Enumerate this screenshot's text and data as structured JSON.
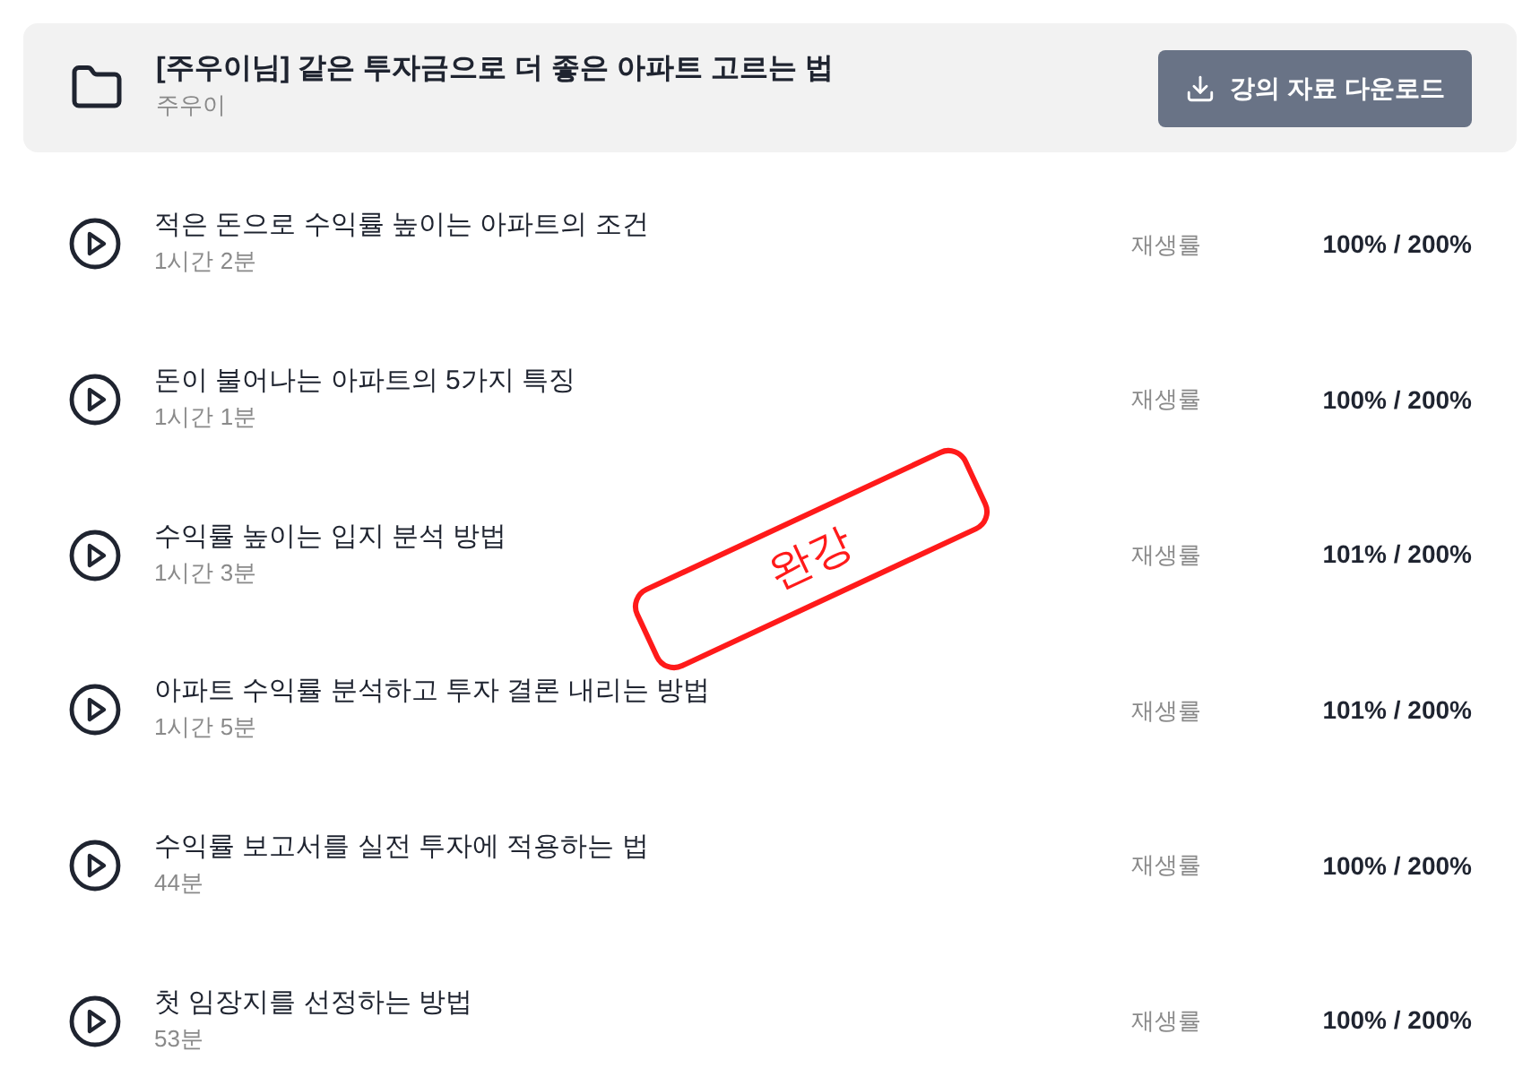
{
  "course": {
    "title": "[주우이님] 같은 투자금으로 더 좋은 아파트 고르는 법",
    "author": "주우이",
    "download_button": "강의 자료 다운로드"
  },
  "lectures": [
    {
      "title": "적은 돈으로 수익률 높이는 아파트의 조건",
      "duration": "1시간 2분",
      "rate_label": "재생률",
      "rate": "100% / 200%"
    },
    {
      "title": "돈이 불어나는 아파트의 5가지 특징",
      "duration": "1시간 1분",
      "rate_label": "재생률",
      "rate": "100% / 200%"
    },
    {
      "title": "수익률 높이는 입지 분석 방법",
      "duration": "1시간 3분",
      "rate_label": "재생률",
      "rate": "101% / 200%"
    },
    {
      "title": "아파트 수익률 분석하고 투자 결론 내리는 방법",
      "duration": "1시간 5분",
      "rate_label": "재생률",
      "rate": "101% / 200%"
    },
    {
      "title": "수익률 보고서를 실전 투자에 적용하는 법",
      "duration": "44분",
      "rate_label": "재생률",
      "rate": "100% / 200%"
    },
    {
      "title": "첫 임장지를 선정하는 방법",
      "duration": "53분",
      "rate_label": "재생률",
      "rate": "100% / 200%"
    }
  ],
  "stamp": {
    "text": "완강"
  }
}
